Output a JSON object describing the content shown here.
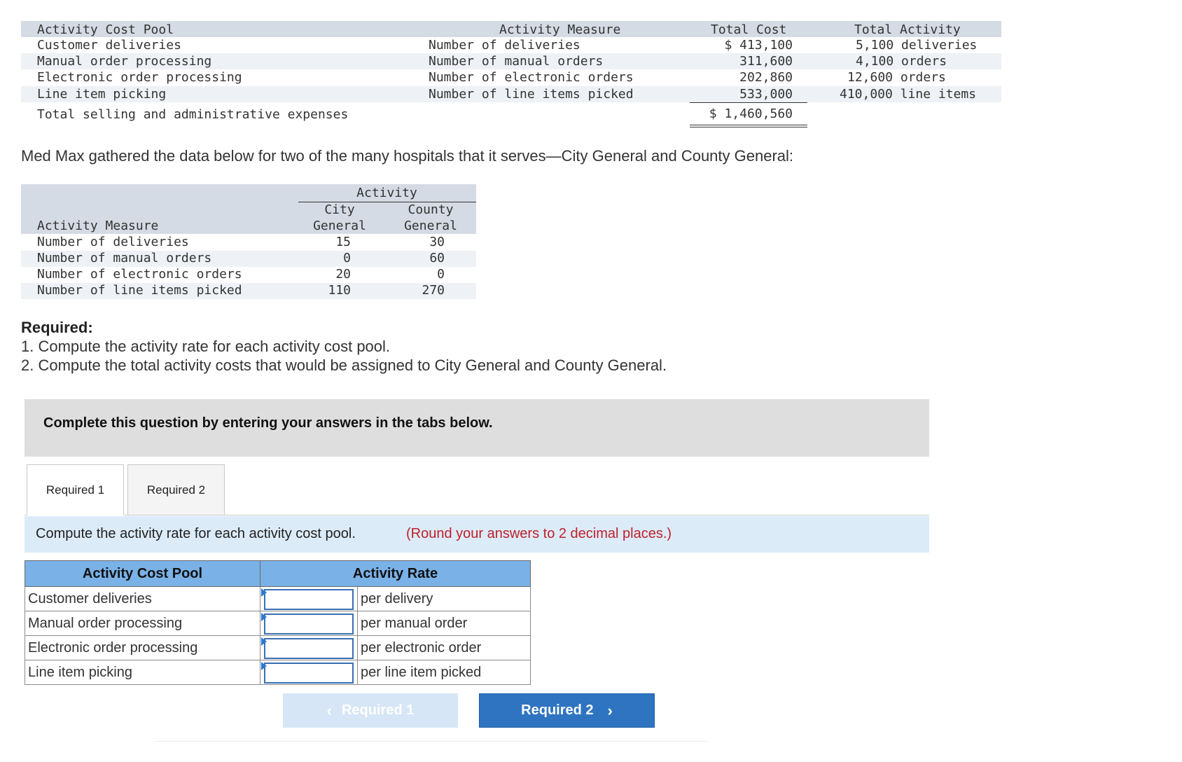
{
  "cost_table": {
    "headers": {
      "pool": "Activity Cost Pool",
      "measure": "Activity Measure",
      "total_cost": "Total Cost",
      "total_activity": "Total Activity"
    },
    "rows": [
      {
        "pool": "Customer deliveries",
        "measure": "Number of deliveries",
        "cost": "$ 413,100",
        "activity": "5,100 deliveries"
      },
      {
        "pool": "Manual order processing",
        "measure": "Number of manual orders",
        "cost": "311,600",
        "activity": "4,100 orders"
      },
      {
        "pool": "Electronic order processing",
        "measure": "Number of electronic orders",
        "cost": "202,860",
        "activity": "12,600 orders"
      },
      {
        "pool": "Line item picking",
        "measure": "Number of line items picked",
        "cost": "533,000",
        "activity": "410,000 line items"
      }
    ],
    "total_label": "Total selling and administrative expenses",
    "total_value": "$ 1,460,560"
  },
  "intro_text": "Med Max gathered the data below for two of the many hospitals that it serves—City General and County General:",
  "hospital_table": {
    "group_header": "Activity",
    "col1_line1": "City",
    "col1_line2": "General",
    "col2_line1": "County",
    "col2_line2": "General",
    "measure_header": "Activity Measure",
    "rows": [
      {
        "measure": "Number of deliveries",
        "city": "15",
        "county": "30"
      },
      {
        "measure": "Number of manual orders",
        "city": "0",
        "county": "60"
      },
      {
        "measure": "Number of electronic orders",
        "city": "20",
        "county": "0"
      },
      {
        "measure": "Number of line items picked",
        "city": "110",
        "county": "270"
      }
    ]
  },
  "required": {
    "heading": "Required:",
    "item1": "1. Compute the activity rate for each activity cost pool.",
    "item2": "2. Compute the total activity costs that would be assigned to City General and County General."
  },
  "instruction": "Complete this question by entering your answers in the tabs below.",
  "tabs": [
    "Required 1",
    "Required 2"
  ],
  "prompt": {
    "main": "Compute the activity rate for each activity cost pool.",
    "note": "(Round your answers to 2 decimal places.)"
  },
  "answer_table": {
    "col1": "Activity Cost Pool",
    "col2": "Activity Rate",
    "rows": [
      {
        "pool": "Customer deliveries",
        "unit": "per delivery",
        "value": ""
      },
      {
        "pool": "Manual order processing",
        "unit": "per manual order",
        "value": ""
      },
      {
        "pool": "Electronic order processing",
        "unit": "per electronic order",
        "value": ""
      },
      {
        "pool": "Line item picking",
        "unit": "per line item picked",
        "value": ""
      }
    ]
  },
  "nav": {
    "prev": "Required 1",
    "next": "Required 2",
    "prev_icon": "chevron-left-icon",
    "next_icon": "chevron-right-icon"
  },
  "colors": {
    "note_red": "#c0202a",
    "button_blue": "#2e74c1",
    "header_blue": "#7ab1e6"
  }
}
